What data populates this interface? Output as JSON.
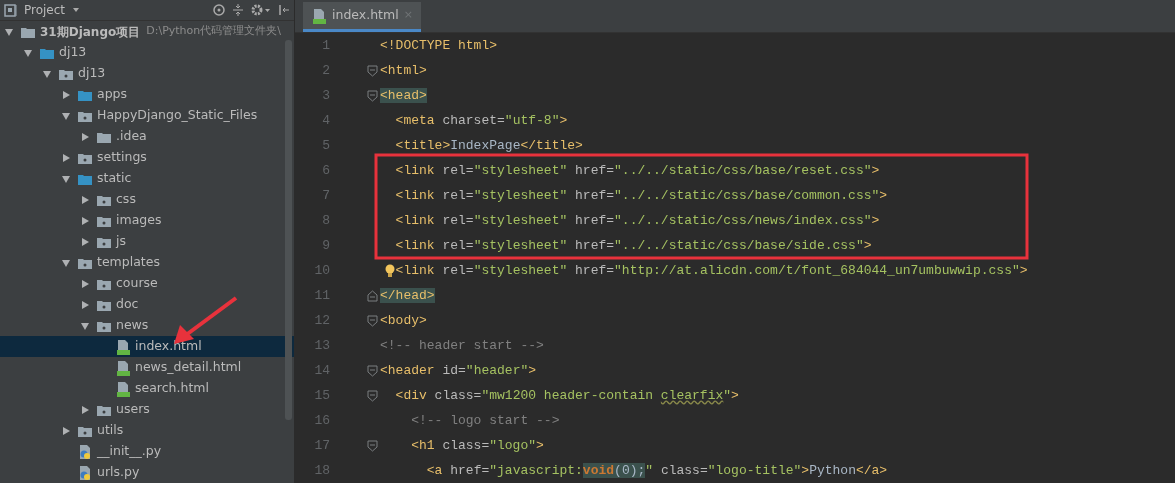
{
  "project_panel": {
    "title": "Project",
    "tree": [
      {
        "name": "31期Django项目",
        "path": "D:\\Python代码管理文件夹\\",
        "kind": "root",
        "expanded": true,
        "selected": false,
        "children": [
          {
            "name": "dj13",
            "kind": "source",
            "expanded": true,
            "selected": false,
            "children": [
              {
                "name": "dj13",
                "kind": "package",
                "expanded": true,
                "selected": false,
                "children": [
                  {
                    "name": "apps",
                    "kind": "source",
                    "expanded": false,
                    "selected": false
                  },
                  {
                    "name": "HappyDjango_Static_Files",
                    "kind": "package",
                    "expanded": true,
                    "selected": false,
                    "children": [
                      {
                        "name": ".idea",
                        "kind": "folder",
                        "expanded": false,
                        "selected": false
                      }
                    ]
                  },
                  {
                    "name": "settings",
                    "kind": "package",
                    "expanded": false,
                    "selected": false
                  },
                  {
                    "name": "static",
                    "kind": "source",
                    "expanded": true,
                    "selected": false,
                    "children": [
                      {
                        "name": "css",
                        "kind": "package",
                        "expanded": false,
                        "selected": false
                      },
                      {
                        "name": "images",
                        "kind": "package",
                        "expanded": false,
                        "selected": false
                      },
                      {
                        "name": "js",
                        "kind": "package",
                        "expanded": false,
                        "selected": false
                      }
                    ]
                  },
                  {
                    "name": "templates",
                    "kind": "package",
                    "expanded": true,
                    "selected": false,
                    "children": [
                      {
                        "name": "course",
                        "kind": "package",
                        "expanded": false,
                        "selected": false
                      },
                      {
                        "name": "doc",
                        "kind": "package",
                        "expanded": false,
                        "selected": false
                      },
                      {
                        "name": "news",
                        "kind": "package",
                        "expanded": true,
                        "selected": false,
                        "children": [
                          {
                            "name": "index.html",
                            "kind": "html",
                            "selected": true
                          },
                          {
                            "name": "news_detail.html",
                            "kind": "html",
                            "selected": false
                          },
                          {
                            "name": "search.html",
                            "kind": "html",
                            "selected": false
                          }
                        ]
                      },
                      {
                        "name": "users",
                        "kind": "package",
                        "expanded": false,
                        "selected": false
                      }
                    ]
                  },
                  {
                    "name": "utils",
                    "kind": "package",
                    "expanded": false,
                    "selected": false
                  },
                  {
                    "name": "__init__.py",
                    "kind": "python",
                    "selected": false
                  },
                  {
                    "name": "urls.py",
                    "kind": "python",
                    "selected": false
                  }
                ]
              }
            ]
          }
        ]
      }
    ]
  },
  "editor": {
    "tabs": [
      {
        "label": "index.html",
        "close": "×",
        "selected": true
      }
    ],
    "lines": [
      {
        "number": "1",
        "segments": [
          {
            "kind": "tag",
            "text": "<!DOCTYPE html>"
          }
        ]
      },
      {
        "number": "2",
        "fold_open": true,
        "segments": [
          {
            "kind": "tag",
            "text": "<html>"
          }
        ]
      },
      {
        "number": "3",
        "fold_open": true,
        "segments": [
          {
            "kind": "tag",
            "text": "<head>",
            "highlighted": true
          }
        ]
      },
      {
        "number": "4",
        "segments": [
          {
            "kind": "tag",
            "text": "  <meta"
          },
          {
            "kind": "attr",
            "text": " charset="
          },
          {
            "kind": "string",
            "text": "\"utf-8\""
          },
          {
            "kind": "tag",
            "text": ">"
          }
        ]
      },
      {
        "number": "5",
        "segments": [
          {
            "kind": "tag",
            "text": "  <title>"
          },
          {
            "kind": "text",
            "text": "IndexPage"
          },
          {
            "kind": "tag",
            "text": "</title>"
          }
        ]
      },
      {
        "number": "6",
        "segments": [
          {
            "kind": "tag",
            "text": "  <link"
          },
          {
            "kind": "attr",
            "text": " rel="
          },
          {
            "kind": "string",
            "text": "\"stylesheet\""
          },
          {
            "kind": "attr",
            "text": " href="
          },
          {
            "kind": "string",
            "text": "\"../../static/css/base/reset.css\""
          },
          {
            "kind": "tag",
            "text": ">"
          }
        ]
      },
      {
        "number": "7",
        "segments": [
          {
            "kind": "tag",
            "text": "  <link"
          },
          {
            "kind": "attr",
            "text": " rel="
          },
          {
            "kind": "string",
            "text": "\"stylesheet\""
          },
          {
            "kind": "attr",
            "text": " href="
          },
          {
            "kind": "string",
            "text": "\"../../static/css/base/common.css\""
          },
          {
            "kind": "tag",
            "text": ">"
          }
        ]
      },
      {
        "number": "8",
        "segments": [
          {
            "kind": "tag",
            "text": "  <link"
          },
          {
            "kind": "attr",
            "text": " rel="
          },
          {
            "kind": "string",
            "text": "\"stylesheet\""
          },
          {
            "kind": "attr",
            "text": " href="
          },
          {
            "kind": "string",
            "text": "\"../../static/css/news/index.css\""
          },
          {
            "kind": "tag",
            "text": ">"
          }
        ]
      },
      {
        "number": "9",
        "segments": [
          {
            "kind": "tag",
            "text": "  <link"
          },
          {
            "kind": "attr",
            "text": " rel="
          },
          {
            "kind": "string",
            "text": "\"stylesheet\""
          },
          {
            "kind": "attr",
            "text": " href="
          },
          {
            "kind": "string",
            "text": "\"../../static/css/base/side.css\""
          },
          {
            "kind": "tag",
            "text": ">"
          }
        ]
      },
      {
        "number": "10",
        "intention": true,
        "segments": [
          {
            "kind": "tag",
            "text": "  <link"
          },
          {
            "kind": "attr",
            "text": " rel="
          },
          {
            "kind": "string",
            "text": "\"stylesheet\""
          },
          {
            "kind": "attr",
            "text": " href="
          },
          {
            "kind": "string",
            "text": "\"http://at.alicdn.com/t/font_684044_un7umbuwwip.css\""
          },
          {
            "kind": "tag",
            "text": ">"
          }
        ]
      },
      {
        "number": "11",
        "fold_close": true,
        "segments": [
          {
            "kind": "tag",
            "text": "</head>",
            "highlighted": true
          }
        ]
      },
      {
        "number": "12",
        "fold_open": true,
        "segments": [
          {
            "kind": "tag",
            "text": "<body>"
          }
        ]
      },
      {
        "number": "13",
        "segments": [
          {
            "kind": "comment",
            "text": "<!-- header start -->"
          }
        ]
      },
      {
        "number": "14",
        "fold_open": true,
        "segments": [
          {
            "kind": "tag",
            "text": "<header"
          },
          {
            "kind": "attr",
            "text": " id="
          },
          {
            "kind": "string",
            "text": "\"header\""
          },
          {
            "kind": "tag",
            "text": ">"
          }
        ]
      },
      {
        "number": "15",
        "fold_open": true,
        "segments": [
          {
            "kind": "tag",
            "text": "  <div"
          },
          {
            "kind": "attr",
            "text": " class="
          },
          {
            "kind": "string",
            "text": "\"mw1200 header-contain "
          },
          {
            "kind": "string",
            "text": "clearfix",
            "squiggle": true
          },
          {
            "kind": "string",
            "text": "\""
          },
          {
            "kind": "tag",
            "text": ">"
          }
        ]
      },
      {
        "number": "16",
        "segments": [
          {
            "kind": "comment",
            "text": "    <!-- logo start -->"
          }
        ]
      },
      {
        "number": "17",
        "fold_open": true,
        "segments": [
          {
            "kind": "tag",
            "text": "    <h1"
          },
          {
            "kind": "attr",
            "text": " class="
          },
          {
            "kind": "string",
            "text": "\"logo\""
          },
          {
            "kind": "tag",
            "text": ">"
          }
        ]
      },
      {
        "number": "18",
        "segments": [
          {
            "kind": "tag",
            "text": "      <a"
          },
          {
            "kind": "attr",
            "text": " href="
          },
          {
            "kind": "string",
            "text": "\"javascript:"
          },
          {
            "kind": "keyword",
            "text": "void",
            "highlighted": true
          },
          {
            "kind": "text",
            "text": "(0);",
            "highlighted": true
          },
          {
            "kind": "string",
            "text": "\""
          },
          {
            "kind": "attr",
            "text": " class="
          },
          {
            "kind": "string",
            "text": "\"logo-title\""
          },
          {
            "kind": "tag",
            "text": ">"
          },
          {
            "kind": "text",
            "text": "Python"
          },
          {
            "kind": "tag",
            "text": "</a>"
          }
        ]
      }
    ]
  }
}
